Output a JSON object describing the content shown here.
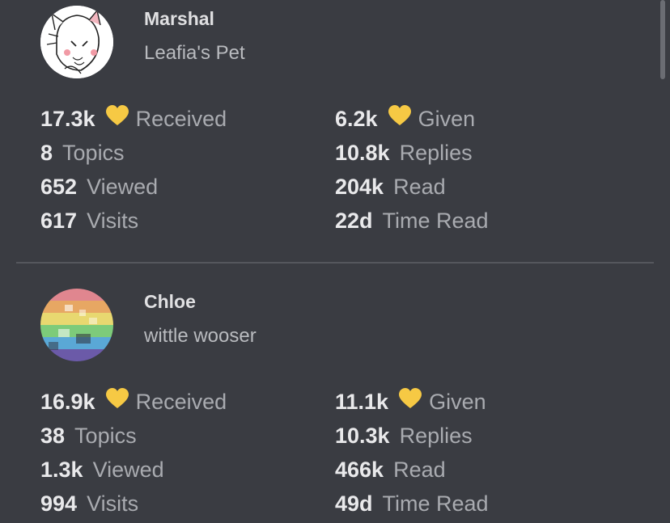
{
  "users": [
    {
      "name": "Marshal",
      "title": "Leafia's Pet",
      "stats": {
        "received": "17.3k",
        "received_label": "Received",
        "given": "6.2k",
        "given_label": "Given",
        "topics": "8",
        "topics_label": "Topics",
        "replies": "10.8k",
        "replies_label": "Replies",
        "viewed": "652",
        "viewed_label": "Viewed",
        "read": "204k",
        "read_label": "Read",
        "visits": "617",
        "visits_label": "Visits",
        "time_read": "22d",
        "time_read_label": "Time Read"
      }
    },
    {
      "name": "Chloe",
      "title": "wittle wooser",
      "stats": {
        "received": "16.9k",
        "received_label": "Received",
        "given": "11.1k",
        "given_label": "Given",
        "topics": "38",
        "topics_label": "Topics",
        "replies": "10.3k",
        "replies_label": "Replies",
        "viewed": "1.3k",
        "viewed_label": "Viewed",
        "read": "466k",
        "read_label": "Read",
        "visits": "994",
        "visits_label": "Visits",
        "time_read": "49d",
        "time_read_label": "Time Read"
      }
    }
  ],
  "icons": {
    "like": "heart-icon"
  },
  "colors": {
    "background": "#3a3c42",
    "heart": "#f6c944",
    "divider": "#55575d"
  }
}
